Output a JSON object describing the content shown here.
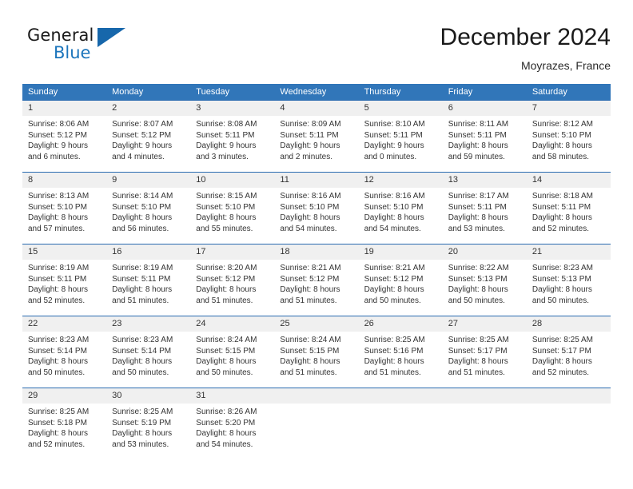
{
  "brand": {
    "general": "General",
    "blue": "Blue",
    "triangle_color": "#1767ab"
  },
  "header": {
    "title": "December 2024",
    "subtitle": "Moyrazes, France"
  },
  "theme": {
    "header_bar": "#3176b9",
    "date_band": "#f0f0f0",
    "week_rule": "#2a6bb0",
    "text": "#333333"
  },
  "weekday_headers": [
    "Sunday",
    "Monday",
    "Tuesday",
    "Wednesday",
    "Thursday",
    "Friday",
    "Saturday"
  ],
  "weeks": [
    [
      {
        "day": "1",
        "sunrise": "Sunrise: 8:06 AM",
        "sunset": "Sunset: 5:12 PM",
        "daylight_1": "Daylight: 9 hours",
        "daylight_2": "and 6 minutes."
      },
      {
        "day": "2",
        "sunrise": "Sunrise: 8:07 AM",
        "sunset": "Sunset: 5:12 PM",
        "daylight_1": "Daylight: 9 hours",
        "daylight_2": "and 4 minutes."
      },
      {
        "day": "3",
        "sunrise": "Sunrise: 8:08 AM",
        "sunset": "Sunset: 5:11 PM",
        "daylight_1": "Daylight: 9 hours",
        "daylight_2": "and 3 minutes."
      },
      {
        "day": "4",
        "sunrise": "Sunrise: 8:09 AM",
        "sunset": "Sunset: 5:11 PM",
        "daylight_1": "Daylight: 9 hours",
        "daylight_2": "and 2 minutes."
      },
      {
        "day": "5",
        "sunrise": "Sunrise: 8:10 AM",
        "sunset": "Sunset: 5:11 PM",
        "daylight_1": "Daylight: 9 hours",
        "daylight_2": "and 0 minutes."
      },
      {
        "day": "6",
        "sunrise": "Sunrise: 8:11 AM",
        "sunset": "Sunset: 5:11 PM",
        "daylight_1": "Daylight: 8 hours",
        "daylight_2": "and 59 minutes."
      },
      {
        "day": "7",
        "sunrise": "Sunrise: 8:12 AM",
        "sunset": "Sunset: 5:10 PM",
        "daylight_1": "Daylight: 8 hours",
        "daylight_2": "and 58 minutes."
      }
    ],
    [
      {
        "day": "8",
        "sunrise": "Sunrise: 8:13 AM",
        "sunset": "Sunset: 5:10 PM",
        "daylight_1": "Daylight: 8 hours",
        "daylight_2": "and 57 minutes."
      },
      {
        "day": "9",
        "sunrise": "Sunrise: 8:14 AM",
        "sunset": "Sunset: 5:10 PM",
        "daylight_1": "Daylight: 8 hours",
        "daylight_2": "and 56 minutes."
      },
      {
        "day": "10",
        "sunrise": "Sunrise: 8:15 AM",
        "sunset": "Sunset: 5:10 PM",
        "daylight_1": "Daylight: 8 hours",
        "daylight_2": "and 55 minutes."
      },
      {
        "day": "11",
        "sunrise": "Sunrise: 8:16 AM",
        "sunset": "Sunset: 5:10 PM",
        "daylight_1": "Daylight: 8 hours",
        "daylight_2": "and 54 minutes."
      },
      {
        "day": "12",
        "sunrise": "Sunrise: 8:16 AM",
        "sunset": "Sunset: 5:10 PM",
        "daylight_1": "Daylight: 8 hours",
        "daylight_2": "and 54 minutes."
      },
      {
        "day": "13",
        "sunrise": "Sunrise: 8:17 AM",
        "sunset": "Sunset: 5:11 PM",
        "daylight_1": "Daylight: 8 hours",
        "daylight_2": "and 53 minutes."
      },
      {
        "day": "14",
        "sunrise": "Sunrise: 8:18 AM",
        "sunset": "Sunset: 5:11 PM",
        "daylight_1": "Daylight: 8 hours",
        "daylight_2": "and 52 minutes."
      }
    ],
    [
      {
        "day": "15",
        "sunrise": "Sunrise: 8:19 AM",
        "sunset": "Sunset: 5:11 PM",
        "daylight_1": "Daylight: 8 hours",
        "daylight_2": "and 52 minutes."
      },
      {
        "day": "16",
        "sunrise": "Sunrise: 8:19 AM",
        "sunset": "Sunset: 5:11 PM",
        "daylight_1": "Daylight: 8 hours",
        "daylight_2": "and 51 minutes."
      },
      {
        "day": "17",
        "sunrise": "Sunrise: 8:20 AM",
        "sunset": "Sunset: 5:12 PM",
        "daylight_1": "Daylight: 8 hours",
        "daylight_2": "and 51 minutes."
      },
      {
        "day": "18",
        "sunrise": "Sunrise: 8:21 AM",
        "sunset": "Sunset: 5:12 PM",
        "daylight_1": "Daylight: 8 hours",
        "daylight_2": "and 51 minutes."
      },
      {
        "day": "19",
        "sunrise": "Sunrise: 8:21 AM",
        "sunset": "Sunset: 5:12 PM",
        "daylight_1": "Daylight: 8 hours",
        "daylight_2": "and 50 minutes."
      },
      {
        "day": "20",
        "sunrise": "Sunrise: 8:22 AM",
        "sunset": "Sunset: 5:13 PM",
        "daylight_1": "Daylight: 8 hours",
        "daylight_2": "and 50 minutes."
      },
      {
        "day": "21",
        "sunrise": "Sunrise: 8:23 AM",
        "sunset": "Sunset: 5:13 PM",
        "daylight_1": "Daylight: 8 hours",
        "daylight_2": "and 50 minutes."
      }
    ],
    [
      {
        "day": "22",
        "sunrise": "Sunrise: 8:23 AM",
        "sunset": "Sunset: 5:14 PM",
        "daylight_1": "Daylight: 8 hours",
        "daylight_2": "and 50 minutes."
      },
      {
        "day": "23",
        "sunrise": "Sunrise: 8:23 AM",
        "sunset": "Sunset: 5:14 PM",
        "daylight_1": "Daylight: 8 hours",
        "daylight_2": "and 50 minutes."
      },
      {
        "day": "24",
        "sunrise": "Sunrise: 8:24 AM",
        "sunset": "Sunset: 5:15 PM",
        "daylight_1": "Daylight: 8 hours",
        "daylight_2": "and 50 minutes."
      },
      {
        "day": "25",
        "sunrise": "Sunrise: 8:24 AM",
        "sunset": "Sunset: 5:15 PM",
        "daylight_1": "Daylight: 8 hours",
        "daylight_2": "and 51 minutes."
      },
      {
        "day": "26",
        "sunrise": "Sunrise: 8:25 AM",
        "sunset": "Sunset: 5:16 PM",
        "daylight_1": "Daylight: 8 hours",
        "daylight_2": "and 51 minutes."
      },
      {
        "day": "27",
        "sunrise": "Sunrise: 8:25 AM",
        "sunset": "Sunset: 5:17 PM",
        "daylight_1": "Daylight: 8 hours",
        "daylight_2": "and 51 minutes."
      },
      {
        "day": "28",
        "sunrise": "Sunrise: 8:25 AM",
        "sunset": "Sunset: 5:17 PM",
        "daylight_1": "Daylight: 8 hours",
        "daylight_2": "and 52 minutes."
      }
    ],
    [
      {
        "day": "29",
        "sunrise": "Sunrise: 8:25 AM",
        "sunset": "Sunset: 5:18 PM",
        "daylight_1": "Daylight: 8 hours",
        "daylight_2": "and 52 minutes."
      },
      {
        "day": "30",
        "sunrise": "Sunrise: 8:25 AM",
        "sunset": "Sunset: 5:19 PM",
        "daylight_1": "Daylight: 8 hours",
        "daylight_2": "and 53 minutes."
      },
      {
        "day": "31",
        "sunrise": "Sunrise: 8:26 AM",
        "sunset": "Sunset: 5:20 PM",
        "daylight_1": "Daylight: 8 hours",
        "daylight_2": "and 54 minutes."
      },
      {
        "day": "",
        "sunrise": "",
        "sunset": "",
        "daylight_1": "",
        "daylight_2": ""
      },
      {
        "day": "",
        "sunrise": "",
        "sunset": "",
        "daylight_1": "",
        "daylight_2": ""
      },
      {
        "day": "",
        "sunrise": "",
        "sunset": "",
        "daylight_1": "",
        "daylight_2": ""
      },
      {
        "day": "",
        "sunrise": "",
        "sunset": "",
        "daylight_1": "",
        "daylight_2": ""
      }
    ]
  ]
}
